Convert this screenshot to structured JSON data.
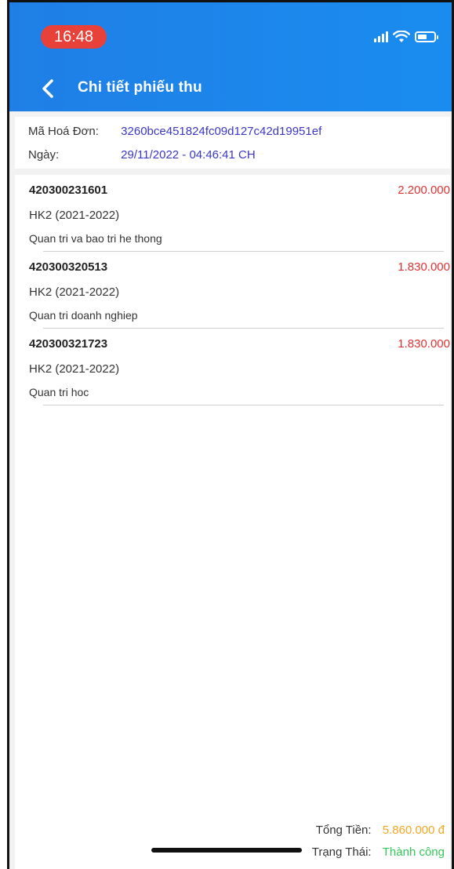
{
  "status_bar": {
    "time": "16:48"
  },
  "header": {
    "title": "Chi tiết phiếu thu",
    "back_icon": "chevron-left-icon",
    "accent_color": "#1f7fe6"
  },
  "invoice": {
    "code_label": "Mã Hoá Đơn:",
    "code_value": "3260bce451824fc09d127c42d19951ef",
    "date_label": "Ngày:",
    "date_value": "29/11/2022 - 04:46:41 CH"
  },
  "items": [
    {
      "code": "420300231601",
      "amount": "2.200.000",
      "term": "HK2 (2021-2022)",
      "name": "Quan tri va bao tri he thong"
    },
    {
      "code": "420300320513",
      "amount": "1.830.000",
      "term": "HK2 (2021-2022)",
      "name": "Quan tri doanh nghiep"
    },
    {
      "code": "420300321723",
      "amount": "1.830.000",
      "term": "HK2 (2021-2022)",
      "name": "Quan tri hoc"
    }
  ],
  "footer": {
    "total_label": "Tổng Tiền:",
    "total_value": "5.860.000 đ",
    "status_label": "Trạng Thái:",
    "status_value": "Thành công",
    "total_color": "#f5a623",
    "status_color": "#34c759"
  }
}
